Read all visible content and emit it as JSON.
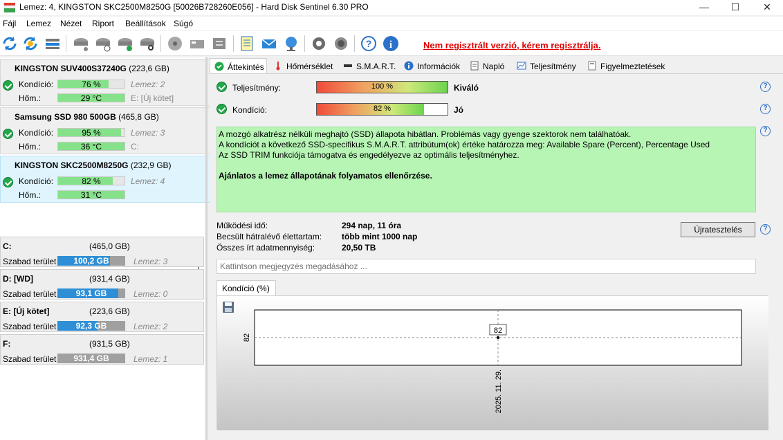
{
  "window": {
    "title": "Lemez: 4, KINGSTON SKC2500M8250G [50026B728260E056]  -  Hard Disk Sentinel 6.30 PRO",
    "minimize": "—",
    "maximize": "☐",
    "close": "✕"
  },
  "menu": {
    "items": [
      "Fájl",
      "Lemez",
      "Nézet",
      "Riport",
      "Beállítások",
      "Súgó"
    ]
  },
  "toolbar": {
    "register_link": "Nem regisztrált verzió, kérem regisztrálja."
  },
  "disks": [
    {
      "name": "KINGSTON SUV400S37240G",
      "size": "(223,6 GB)",
      "condition_label": "Kondíció:",
      "condition": "76 %",
      "condition_level": 0.76,
      "condition_aside": "Lemez: 2",
      "temp_label": "Hőm.:",
      "temp": "29 °C",
      "temp_aside": "E: [Új kötet]"
    },
    {
      "name": "Samsung SSD 980 500GB",
      "size": "(465,8 GB)",
      "condition_label": "Kondíció:",
      "condition": "95 %",
      "condition_level": 0.95,
      "condition_aside": "Lemez: 3",
      "temp_label": "Hőm.:",
      "temp": "36 °C",
      "temp_aside": "C:"
    },
    {
      "name": "KINGSTON SKC2500M8250G",
      "size": "(232,9 GB)",
      "condition_label": "Kondíció:",
      "condition": "82 %",
      "condition_level": 0.82,
      "condition_aside": "Lemez: 4",
      "temp_label": "Hőm.:",
      "temp": "31 °C",
      "temp_aside": ""
    }
  ],
  "volumes": [
    {
      "name": "C:",
      "size": "(465,0 GB)",
      "free_label": "Szabad terület",
      "free": "100,2 GB",
      "used_fraction": 0.78,
      "disk": "Lemez: 3"
    },
    {
      "name": "D: [WD]",
      "size": "(931,4 GB)",
      "free_label": "Szabad terület",
      "free": "93,1 GB",
      "used_fraction": 0.9,
      "disk": "Lemez: 0"
    },
    {
      "name": "E: [Új kötet]",
      "size": "(223,6 GB)",
      "free_label": "Szabad terület",
      "free": "92,3 GB",
      "used_fraction": 0.59,
      "disk": "Lemez: 2"
    },
    {
      "name": "F:",
      "size": "(931,5 GB)",
      "free_label": "Szabad terület",
      "free": "931,4 GB",
      "used_fraction": 0.0,
      "disk": "Lemez: 1"
    }
  ],
  "tabs": [
    "Áttekintés",
    "Hőmérséklet",
    "S.M.A.R.T.",
    "Információk",
    "Napló",
    "Teljesítmény",
    "Figyelmeztetések"
  ],
  "overview": {
    "performance_label": "Teljesítmény:",
    "performance_value": "100 %",
    "performance_level": 1.0,
    "performance_rating": "Kiváló",
    "condition_label": "Kondíció:",
    "condition_value": "82 %",
    "condition_level": 0.82,
    "condition_rating": "Jó",
    "info_lines": [
      "A mozgó alkatrész nélküli meghajtó (SSD) állapota hibátlan. Problémás vagy gyenge szektorok nem találhatóak.",
      "A kondíciót a következő SSD-specifikus S.M.A.R.T. attribútum(ok) értéke határozza meg:  Available Spare (Percent), Percentage Used",
      "Az SSD TRIM funkciója támogatva és engedélyezve az optimális teljesítményhez."
    ],
    "recommendation": "Ajánlatos a lemez állapotának folyamatos ellenőrzése.",
    "uptime_label": "Működési idő:",
    "uptime_value": "294 nap, 11 óra",
    "remaining_label": "Becsült hátralévő élettartam:",
    "remaining_value": "több mint 1000 nap",
    "written_label": "Összes írt adatmennyiség:",
    "written_value": "20,50 TB",
    "retest_button": "Újratesztelés",
    "note_placeholder": "Kattintson megjegyzés megadásához ...",
    "help": "?"
  },
  "chart_data": {
    "type": "line",
    "tab_label": "Kondíció  (%)",
    "x": [
      "2025. 11. 29."
    ],
    "series": [
      {
        "values": [
          82
        ]
      }
    ],
    "y_tick": "82",
    "data_label": "82"
  }
}
